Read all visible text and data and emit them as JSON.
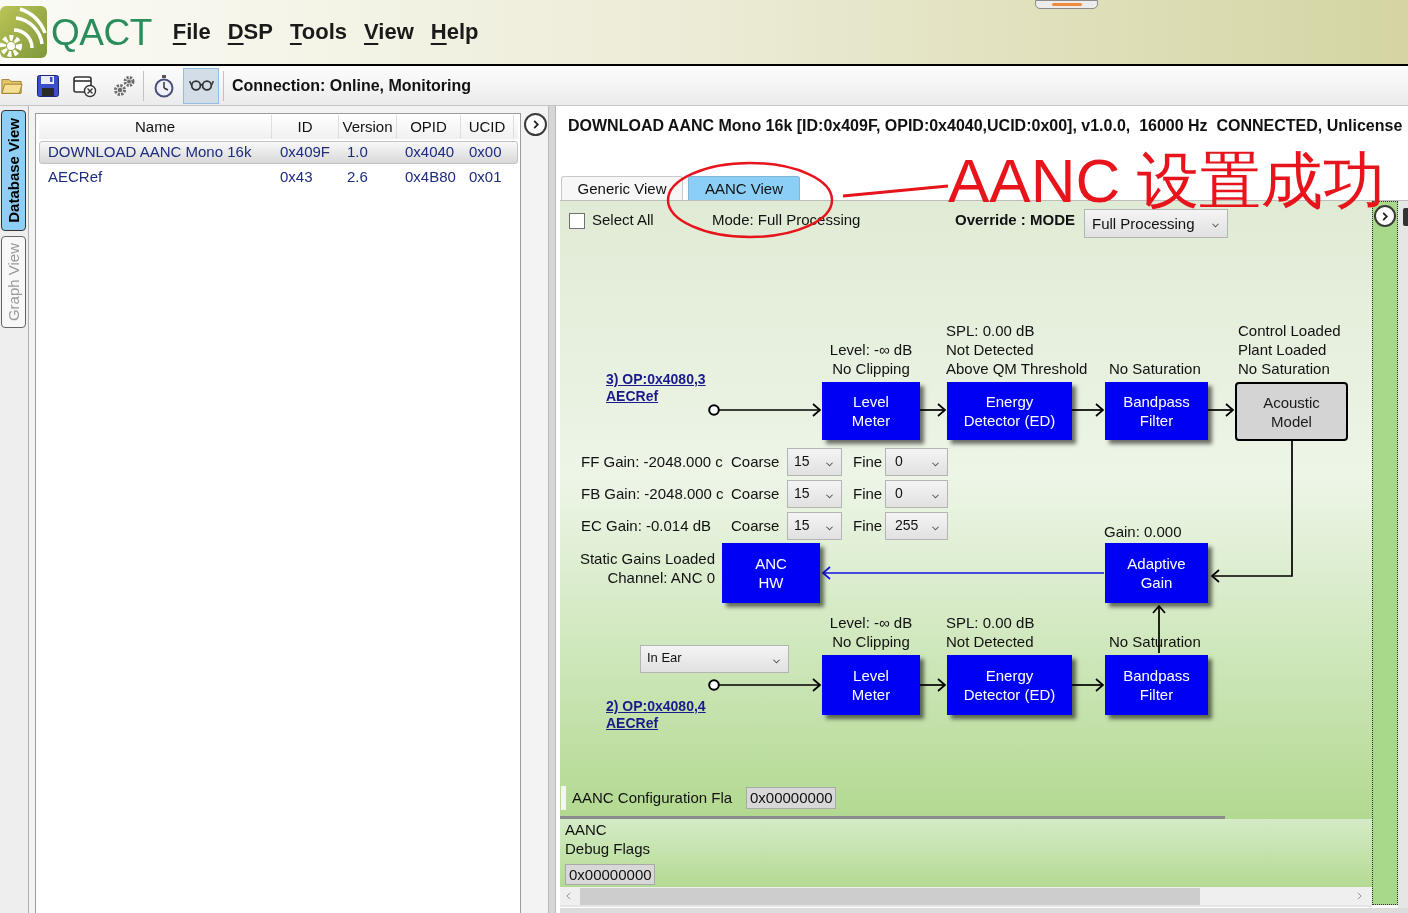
{
  "menubar": {
    "logo_text": "QACT",
    "menus": [
      {
        "key": "F",
        "rest": "ile"
      },
      {
        "key": "D",
        "rest": "SP"
      },
      {
        "key": "T",
        "rest": "ools"
      },
      {
        "key": "V",
        "rest": "iew"
      },
      {
        "key": "H",
        "rest": "elp"
      }
    ]
  },
  "toolbar": {
    "buttons": [
      {
        "kind": "open",
        "selected": false
      },
      {
        "kind": "save",
        "selected": false
      },
      {
        "kind": "close",
        "selected": false
      },
      {
        "kind": "settings",
        "selected": false
      },
      {
        "kind": "timer",
        "selected": false
      },
      {
        "kind": "monitor",
        "selected": true
      }
    ],
    "status": "Connection: Online, Monitoring"
  },
  "side_tabs": [
    {
      "label": "Database View",
      "selected": true
    },
    {
      "label": "Graph View",
      "selected": false
    }
  ],
  "module_table": {
    "columns": [
      "Name",
      "ID",
      "Version",
      "OPID",
      "UCID"
    ],
    "rows": [
      {
        "cells": [
          "DOWNLOAD AANC Mono 16k",
          "0x409F",
          "1.0",
          "0x4040",
          "0x00"
        ],
        "selected": true
      },
      {
        "cells": [
          "AECRef",
          "0x43",
          "2.6",
          "0x4B80",
          "0x01"
        ],
        "selected": false
      }
    ]
  },
  "module_panel": {
    "header": "DOWNLOAD AANC Mono 16k [ID:0x409F, OPID:0x4040,UCID:0x00], v1.0.0,  16000 Hz  CONNECTED, Unlicense",
    "tabs": [
      {
        "label": "Generic View",
        "selected": false
      },
      {
        "label": "AANC View",
        "selected": true
      }
    ],
    "select_all": {
      "label": "Select All",
      "checked": false
    },
    "mode": "Mode: Full Processing",
    "override": {
      "label": "Override : MODE",
      "value": "Full Processing"
    },
    "diagram": {
      "top_chain": {
        "input_link": [
          "3) OP:0x4080,3",
          "AECRef"
        ],
        "blocks": [
          {
            "kind": "processing",
            "label": [
              "Level",
              "Meter"
            ],
            "status": [
              "Level: -∞ dB",
              "No Clipping"
            ]
          },
          {
            "kind": "processing",
            "label": [
              "Energy",
              "Detector (ED)"
            ],
            "status": [
              "SPL: 0.00 dB",
              "Not Detected",
              "Above QM Threshold"
            ]
          },
          {
            "kind": "processing",
            "label": [
              "Bandpass",
              "Filter"
            ],
            "status": [
              "No Saturation"
            ]
          },
          {
            "kind": "model",
            "label": [
              "Acoustic",
              "Model"
            ],
            "status": [
              "Control Loaded",
              "Plant Loaded",
              "No Saturation"
            ]
          }
        ]
      },
      "gains": [
        {
          "label": "FF Gain: -2048.000 c",
          "coarse_label": "Coarse",
          "coarse": "15",
          "fine_label": "Fine",
          "fine": "0"
        },
        {
          "label": "FB Gain: -2048.000 c",
          "coarse_label": "Coarse",
          "coarse": "15",
          "fine_label": "Fine",
          "fine": "0"
        },
        {
          "label": "EC Gain: -0.014 dB",
          "coarse_label": "Coarse",
          "coarse": "15",
          "fine_label": "Fine",
          "fine": "255"
        }
      ],
      "anc_hw": {
        "kind": "processing",
        "status": [
          "Static Gains Loaded",
          "Channel: ANC 0"
        ],
        "label": [
          "ANC",
          "HW"
        ]
      },
      "adaptive_gain": {
        "kind": "processing",
        "status": [
          "Gain: 0.000"
        ],
        "label": [
          "Adaptive",
          "Gain"
        ]
      },
      "bottom_chain": {
        "selector": "In Ear",
        "input_link": [
          "2) OP:0x4080,4",
          "AECRef"
        ],
        "blocks": [
          {
            "kind": "processing",
            "label": [
              "Level",
              "Meter"
            ],
            "status": [
              "Level: -∞ dB",
              "No Clipping"
            ]
          },
          {
            "kind": "processing",
            "label": [
              "Energy",
              "Detector (ED)"
            ],
            "status": [
              "SPL: 0.00 dB",
              "Not Detected"
            ]
          },
          {
            "kind": "processing",
            "label": [
              "Bandpass",
              "Filter"
            ],
            "status": [
              "No Saturation"
            ]
          }
        ]
      }
    },
    "config_flags": {
      "label": "AANC Configuration Fla",
      "value": "0x00000000"
    },
    "debug_flags": {
      "label": [
        "AANC",
        "Debug Flags"
      ],
      "value": "0x00000000"
    }
  },
  "annotation": {
    "text": "AANC 设置成功"
  }
}
